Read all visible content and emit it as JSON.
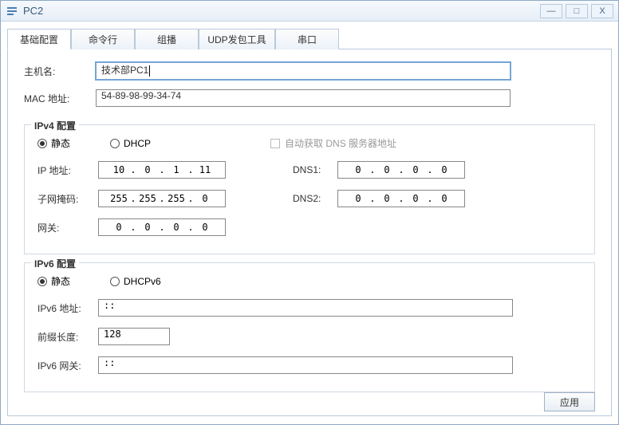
{
  "window": {
    "title": "PC2"
  },
  "winbtns": {
    "min": "—",
    "max": "□",
    "close": "X"
  },
  "tabs": [
    {
      "label": "基础配置",
      "active": true
    },
    {
      "label": "命令行"
    },
    {
      "label": "组播"
    },
    {
      "label": "UDP发包工具"
    },
    {
      "label": "串口"
    }
  ],
  "host": {
    "label": "主机名:",
    "value": "技术部PC1"
  },
  "mac": {
    "label": "MAC 地址:",
    "value": "54-89-98-99-34-74"
  },
  "ipv4": {
    "legend": "IPv4 配置",
    "radio_static": "静态",
    "radio_dhcp": "DHCP",
    "auto_dns": "自动获取 DNS 服务器地址",
    "ip_label": "IP 地址:",
    "mask_label": "子网掩码:",
    "gw_label": "网关:",
    "dns1_label": "DNS1:",
    "dns2_label": "DNS2:",
    "ip": [
      "10",
      "0",
      "1",
      "11"
    ],
    "mask": [
      "255",
      "255",
      "255",
      "0"
    ],
    "gw": [
      "0",
      "0",
      "0",
      "0"
    ],
    "dns1": [
      "0",
      "0",
      "0",
      "0"
    ],
    "dns2": [
      "0",
      "0",
      "0",
      "0"
    ]
  },
  "ipv6": {
    "legend": "IPv6 配置",
    "radio_static": "静态",
    "radio_dhcp": "DHCPv6",
    "addr_label": "IPv6 地址:",
    "prefix_label": "前缀长度:",
    "gw_label": "IPv6 网关:",
    "addr": "::",
    "prefix": "128",
    "gw": "::"
  },
  "apply": "应用"
}
